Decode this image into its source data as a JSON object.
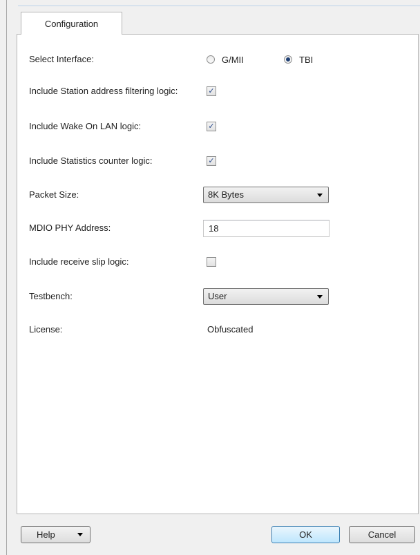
{
  "tab": {
    "label": "Configuration"
  },
  "form": {
    "interface": {
      "label": "Select Interface:",
      "options": [
        "G/MII",
        "TBI"
      ],
      "selected": "TBI"
    },
    "station_filter": {
      "label": "Include Station address filtering logic:",
      "checked": true
    },
    "wake_on_lan": {
      "label": "Include Wake On LAN logic:",
      "checked": true
    },
    "stats_counter": {
      "label": "Include Statistics counter logic:",
      "checked": true
    },
    "packet_size": {
      "label": "Packet Size:",
      "value": "8K Bytes"
    },
    "mdio": {
      "label": "MDIO PHY Address:",
      "value": "18"
    },
    "receive_slip": {
      "label": "Include receive slip logic:",
      "checked": false
    },
    "testbench": {
      "label": "Testbench:",
      "value": "User"
    },
    "license": {
      "label": "License:",
      "value": "Obfuscated"
    }
  },
  "buttons": {
    "help": "Help",
    "ok": "OK",
    "cancel": "Cancel"
  },
  "icons": {
    "checkmark": "✓"
  }
}
